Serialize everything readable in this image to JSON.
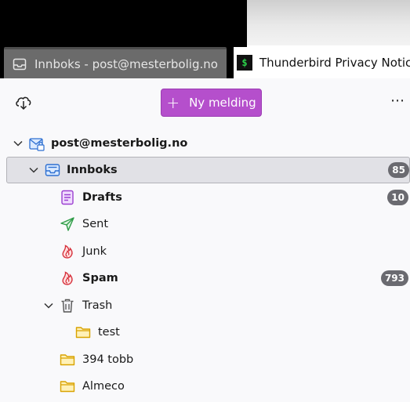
{
  "tabs": [
    {
      "label": "Innboks - post@mesterbolig.no",
      "icon": "inbox-tab-icon",
      "active": true
    },
    {
      "label": "Thunderbird Privacy Notice —",
      "icon": "terminal-tab-icon",
      "active": false
    }
  ],
  "toolbar": {
    "new_message_label": "Ny melding",
    "new_message_icon": "plus-icon",
    "more_label": "⋯",
    "accent": "#b54fcc"
  },
  "account": {
    "name": "post@mesterbolig.no",
    "icon": "account-mail-icon"
  },
  "folders": [
    {
      "name": "Innboks",
      "count": "85",
      "bold": true,
      "selected": true,
      "icon": "inbox-icon"
    },
    {
      "name": "Drafts",
      "count": "10",
      "bold": true,
      "icon": "drafts-icon"
    },
    {
      "name": "Sent",
      "count": "",
      "bold": false,
      "icon": "sent-icon"
    },
    {
      "name": "Junk",
      "count": "",
      "bold": false,
      "icon": "junk-icon"
    },
    {
      "name": "Spam",
      "count": "793",
      "bold": true,
      "icon": "spam-icon"
    },
    {
      "name": "Trash",
      "count": "",
      "bold": false,
      "icon": "trash-icon"
    },
    {
      "name": "test",
      "count": "",
      "bold": false,
      "icon": "folder-icon"
    },
    {
      "name": "394 tobb",
      "count": "",
      "bold": false,
      "icon": "folder-icon"
    },
    {
      "name": "Almeco",
      "count": "",
      "bold": false,
      "icon": "folder-icon"
    }
  ]
}
